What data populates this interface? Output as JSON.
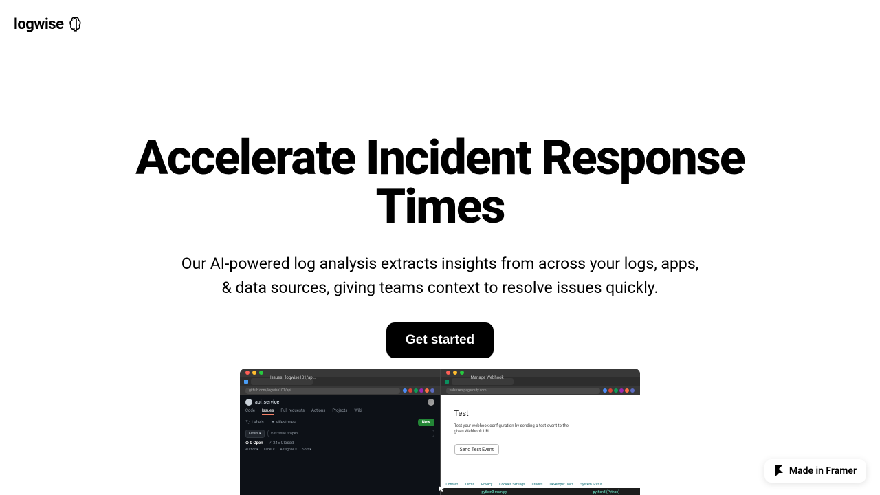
{
  "header": {
    "brand": "logwise"
  },
  "hero": {
    "title": "Accelerate Incident Response Times",
    "subtitle": "Our AI-powered log analysis extracts insights from across your logs, apps, & data sources, giving teams context to resolve issues quickly.",
    "cta": "Get started"
  },
  "preview": {
    "left": {
      "tabTitle": "Issues · logwise101/api…",
      "url": "github.com/logwise101/api…",
      "repo": "api_service",
      "tabs": [
        "Code",
        "Issues",
        "Pull requests",
        "Actions",
        "Projects",
        "Wiki"
      ],
      "labels": "Labels",
      "milestones": "Milestones",
      "newBtn": "New",
      "filtersBtn": "Filters",
      "searchPlaceholder": "is:issue is:open",
      "openCountLabel": "0 Open",
      "closedCountLabel": "245 Closed",
      "sortOptions": [
        "Author",
        "Label",
        "Assignee",
        "Sort"
      ]
    },
    "right": {
      "tabTitle": "Manage Webhook",
      "url": "saleszen.pagerduty.com…",
      "cardTitle": "Test",
      "cardBody": "Test your webhook configuration by sending a test event to the given Webhook URL.",
      "sendBtn": "Send Test Event",
      "footerLinks": [
        "Contact",
        "Terms",
        "Privacy",
        "Cookies Settings",
        "Credits",
        "Developer Docs",
        "System Status"
      ]
    },
    "bottom": {
      "fileLabel": "python3 main.py",
      "langLabel": "python3 (Python)"
    }
  },
  "framerBadge": {
    "text": "Made in Framer"
  },
  "extColors": [
    "#4c8bf5",
    "#db4437",
    "#0f9d58",
    "#9c27b0",
    "#ff7043",
    "#5c6bc0"
  ]
}
